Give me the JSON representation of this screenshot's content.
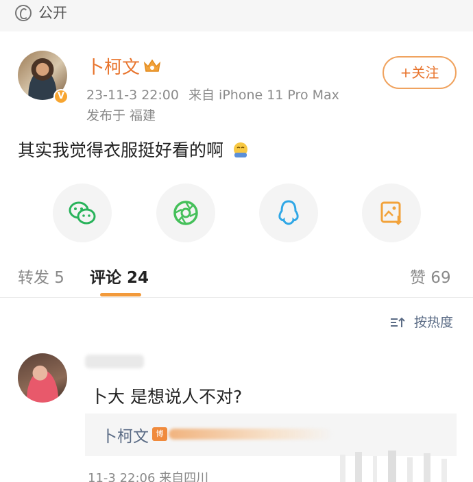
{
  "visibility": {
    "label": "公开",
    "icon": "globe-icon"
  },
  "post": {
    "author": "卜柯文",
    "verified_badge": "V",
    "time": "23-11-3 22:00",
    "source": "来自 iPhone 11 Pro Max",
    "location": "发布于 福建",
    "follow_label": "+关注",
    "content": "其实我觉得衣服挺好看的啊",
    "content_emoji": "emoji-icon"
  },
  "share": [
    {
      "name": "wechat-share-icon"
    },
    {
      "name": "moments-share-icon"
    },
    {
      "name": "qq-share-icon"
    },
    {
      "name": "save-image-icon"
    }
  ],
  "tabs": {
    "repost": "转发 5",
    "comments": "评论 24",
    "likes": "赞 69"
  },
  "sort_label": "按热度",
  "comment": {
    "text": "卜大 是想说人不对?",
    "reply_author": "卜柯文",
    "reply_badge": "博",
    "meta": "11-3 22:06 来自四川"
  },
  "colors": {
    "accent": "#e8742d",
    "link": "#5a6b85",
    "wechat": "#29b35b",
    "moments": "#45c05a",
    "qq": "#2fa7e6",
    "save": "#f2a23a"
  }
}
